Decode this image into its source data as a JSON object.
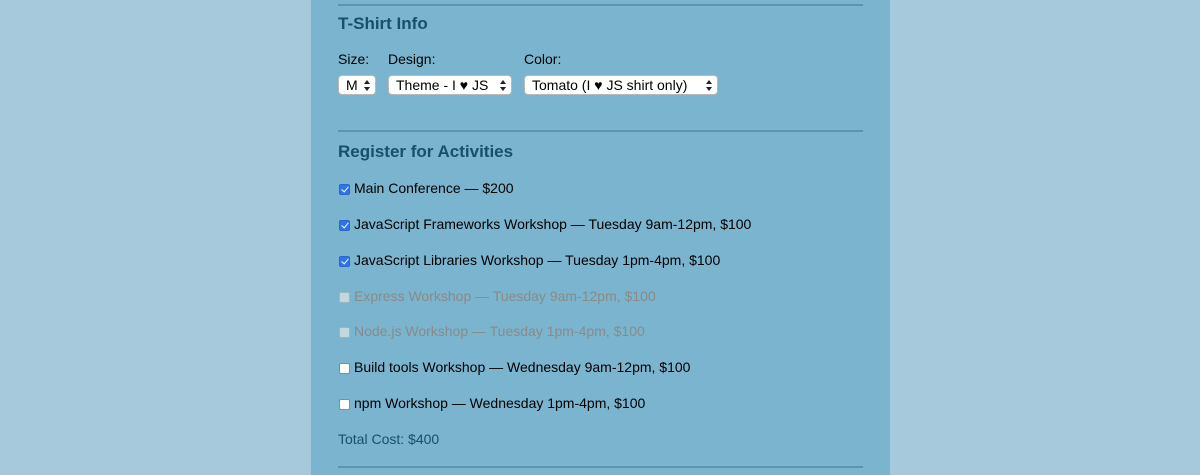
{
  "tshirt": {
    "title": "T-Shirt Info",
    "size_label": "Size:",
    "size_value": "M",
    "design_label": "Design:",
    "design_value": "Theme - I ♥ JS",
    "color_label": "Color:",
    "color_value": "Tomato (I ♥ JS shirt only)"
  },
  "activities": {
    "title": "Register for Activities",
    "items": [
      {
        "label": "Main Conference — $200",
        "checked": true,
        "disabled": false
      },
      {
        "label": "JavaScript Frameworks Workshop — Tuesday 9am-12pm, $100",
        "checked": true,
        "disabled": false
      },
      {
        "label": "JavaScript Libraries Workshop — Tuesday 1pm-4pm, $100",
        "checked": true,
        "disabled": false
      },
      {
        "label": "Express Workshop — Tuesday 9am-12pm, $100",
        "checked": false,
        "disabled": true
      },
      {
        "label": "Node.js Workshop — Tuesday 1pm-4pm, $100",
        "checked": false,
        "disabled": true
      },
      {
        "label": "Build tools Workshop — Wednesday 9am-12pm, $100",
        "checked": false,
        "disabled": false
      },
      {
        "label": "npm Workshop — Wednesday 1pm-4pm, $100",
        "checked": false,
        "disabled": false
      }
    ],
    "total": "Total Cost: $400"
  },
  "colors": {
    "page_background": "#a6cadb",
    "panel_background": "#7bb4cf",
    "heading": "#184f69",
    "checkbox_checked": "#2f73e8",
    "disabled_text": "#8a8a86"
  }
}
